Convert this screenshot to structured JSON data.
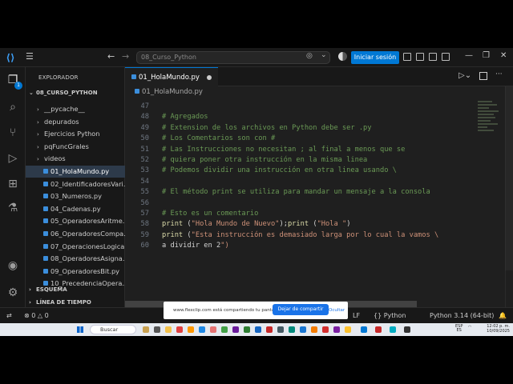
{
  "titlebar": {
    "search_text": "08_Curso_Python",
    "signin_label": "Iniciar sesión"
  },
  "activity": {
    "badge": "1"
  },
  "sidebar": {
    "title": "EXPLORADOR",
    "folder": "08_CURSO_PYTHON",
    "items": [
      {
        "label": "__pycache__",
        "type": "folder"
      },
      {
        "label": "depurados",
        "type": "folder"
      },
      {
        "label": "Ejercicios Python",
        "type": "folder"
      },
      {
        "label": "pqFuncGrales",
        "type": "folder"
      },
      {
        "label": "videos",
        "type": "folder"
      },
      {
        "label": "01_HolaMundo.py",
        "type": "file",
        "selected": true
      },
      {
        "label": "02_IdentificadoresVari...",
        "type": "file"
      },
      {
        "label": "03_Numeros.py",
        "type": "file"
      },
      {
        "label": "04_Cadenas.py",
        "type": "file"
      },
      {
        "label": "05_OperadoresAritme...",
        "type": "file"
      },
      {
        "label": "06_OperadoresCompa...",
        "type": "file"
      },
      {
        "label": "07_OperacionesLogica...",
        "type": "file"
      },
      {
        "label": "08_OperadoresAsigna...",
        "type": "file"
      },
      {
        "label": "09_OperadoresBit.py",
        "type": "file"
      },
      {
        "label": "10_PrecedenciaOpera...",
        "type": "file"
      }
    ],
    "outline": "ESQUEMA",
    "timeline": "LÍNEA DE TIEMPO"
  },
  "editor": {
    "tab_label": "01_HolaMundo.py",
    "breadcrumb": "01_HolaMundo.py",
    "lines": [
      {
        "n": "47",
        "text": ""
      },
      {
        "n": "48",
        "text": "# Agregados"
      },
      {
        "n": "49",
        "text": "# Extension de los archivos en Python debe ser .py"
      },
      {
        "n": "50",
        "text": "# Los Comentarios son con #"
      },
      {
        "n": "51",
        "text": "# Las Instrucciones no necesitan ; al final a menos que se"
      },
      {
        "n": "52",
        "text": "# quiera poner otra instrucción en la misma linea"
      },
      {
        "n": "53",
        "text": "# Podemos dividir una instrucción en otra linea usando \\"
      },
      {
        "n": "54",
        "text": ""
      },
      {
        "n": "55",
        "text": "# El método print se utiliza para mandar un mensaje a la consola"
      },
      {
        "n": "56",
        "text": ""
      },
      {
        "n": "57",
        "text": "# Esto es un comentario"
      },
      {
        "n": "58",
        "text": "print (\"Hola Mundo de Nuevo\");print (\"Hola \")"
      },
      {
        "n": "59",
        "text": "print (\"Esta instrucción es demasiado larga por lo cual la vamos \\"
      },
      {
        "n": "60",
        "text": "a dividir en 2\")"
      }
    ]
  },
  "statusbar": {
    "errors": "0",
    "warnings": "0",
    "eol": "LF",
    "language": "Python",
    "interpreter": "Python 3.14 (64-bit)"
  },
  "share": {
    "message": "www.flexclip.com está compartiendo tu pantalla.",
    "stop_label": "Dejar de compartir",
    "hide_label": "Ocultar"
  },
  "taskbar": {
    "search_label": "Buscar",
    "lang": "ESP",
    "lang2": "ES",
    "time": "12:02 p. m.",
    "date": "10/09/2025"
  }
}
